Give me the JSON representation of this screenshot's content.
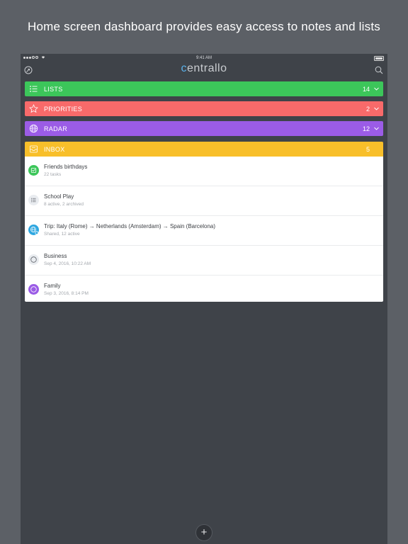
{
  "headline": "Home screen dashboard provides easy access to notes and lists",
  "status_bar": {
    "time": "9:41 AM"
  },
  "app": {
    "logo_prefix": "c",
    "logo_rest": "entrallo"
  },
  "categories": [
    {
      "label": "LISTS",
      "count": "14",
      "color": "#3cc65a",
      "icon": "list-icon"
    },
    {
      "label": "PRIORITIES",
      "count": "2",
      "color": "#f86a6a",
      "icon": "star-icon"
    },
    {
      "label": "RADAR",
      "count": "12",
      "color": "#9b5ce6",
      "icon": "globe-icon"
    },
    {
      "label": "INBOX",
      "count": "5",
      "color": "#f8bf2a",
      "icon": "inbox-icon"
    }
  ],
  "inbox_items": [
    {
      "title": "Friends birthdays",
      "subtitle": "22 tasks",
      "icon": "check-note-icon",
      "color": "#3cc65a"
    },
    {
      "title": "School Play",
      "subtitle": "8 active, 2 archived",
      "icon": "list-icon",
      "color": "#e9ecf0"
    },
    {
      "title": "Trip: Italy (Rome) → Netherlands (Amsterdam) → Spain (Barcelona)",
      "subtitle": "Shared, 12 active",
      "icon": "shared-globe-icon",
      "color": "#2fa7e0"
    },
    {
      "title": "Business",
      "subtitle": "Sep 4, 2016, 10:22 AM",
      "icon": "circle-icon",
      "color": "#e9ecf0"
    },
    {
      "title": "Family",
      "subtitle": "Sep 3, 2016, 8:14 PM",
      "icon": "circle-icon",
      "color": "#9b5ce6"
    }
  ],
  "fab": {
    "label": "+"
  }
}
